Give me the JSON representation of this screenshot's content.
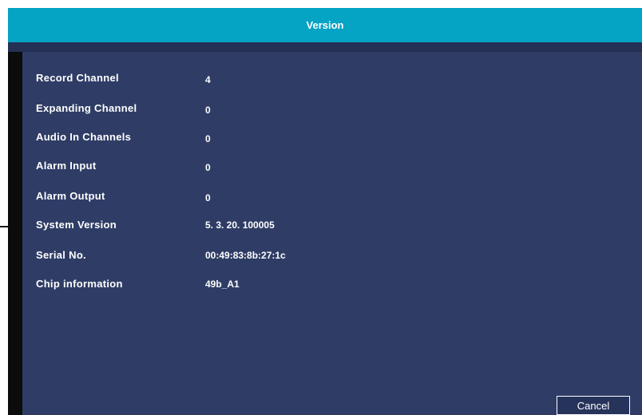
{
  "dialog": {
    "title": "Version",
    "rows": [
      {
        "label": "Record Channel",
        "value": "4"
      },
      {
        "label": "Expanding Channel",
        "value": "0"
      },
      {
        "label": "Audio In Channels",
        "value": "0"
      },
      {
        "label": "Alarm Input",
        "value": "0"
      },
      {
        "label": "Alarm Output",
        "value": "0"
      },
      {
        "label": "System Version",
        "value": "5. 3. 20. 100005"
      },
      {
        "label": "Serial No.",
        "value": "00:49:83:8b:27:1c"
      },
      {
        "label": "Chip information",
        "value": "49b_A1"
      }
    ],
    "cancel_label": "Cancel"
  },
  "colors": {
    "titlebar": "#05a3c4",
    "panel": "#2f3d66",
    "text": "#ffffff"
  }
}
